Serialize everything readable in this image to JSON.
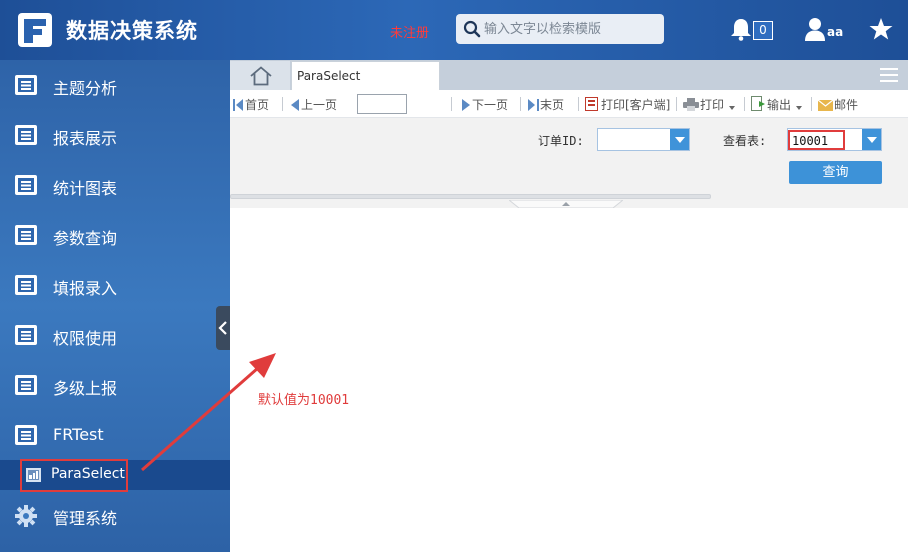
{
  "header": {
    "title": "数据决策系统",
    "unregistered": "未注册",
    "search_placeholder": "输入文字以检索模版",
    "notification_count": "0",
    "user_name": "aa"
  },
  "sidebar": {
    "items": [
      {
        "label": "主题分析",
        "icon": "report-icon"
      },
      {
        "label": "报表展示",
        "icon": "report-icon"
      },
      {
        "label": "统计图表",
        "icon": "report-icon"
      },
      {
        "label": "参数查询",
        "icon": "report-icon"
      },
      {
        "label": "填报录入",
        "icon": "report-icon"
      },
      {
        "label": "权限使用",
        "icon": "report-icon"
      },
      {
        "label": "多级上报",
        "icon": "report-icon"
      },
      {
        "label": "FRTest",
        "icon": "report-icon"
      }
    ],
    "sub_item": {
      "label": "ParaSelect",
      "icon": "template-icon"
    },
    "last_item": {
      "label": "管理系统",
      "icon": "gear-icon"
    }
  },
  "tabs": {
    "active_tab": "ParaSelect"
  },
  "toolbar": {
    "first_page": "首页",
    "prev_page": "上一页",
    "next_page": "下一页",
    "last_page": "末页",
    "print_client": "打印[客户端]",
    "print": "打印",
    "export": "输出",
    "email": "邮件"
  },
  "params": {
    "order_id_label": "订单ID:",
    "order_id_value": "",
    "view_table_label": "查看表:",
    "view_table_value": "10001",
    "query_button": "查询"
  },
  "annotation": {
    "text": "默认值为10001"
  },
  "colors": {
    "header_bg": "#2c68b7",
    "sidebar_bg": "#3b79bf",
    "accent_blue": "#3d92d8",
    "highlight_red": "#e03c3c"
  }
}
